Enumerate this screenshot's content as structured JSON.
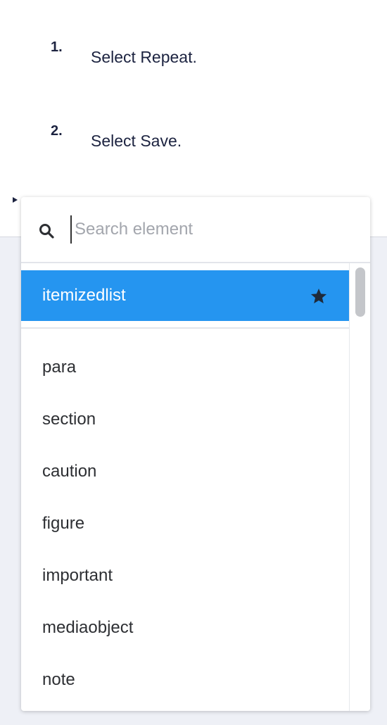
{
  "steps": [
    {
      "number": "1.",
      "text": "Select Repeat."
    },
    {
      "number": "2.",
      "text": "Select Save."
    }
  ],
  "dropdown": {
    "search": {
      "placeholder": "Search element",
      "icon": "search-icon"
    },
    "favorites": [
      {
        "label": "itemizedlist",
        "icon": "star-icon",
        "selected": true
      }
    ],
    "items": [
      {
        "label": "para"
      },
      {
        "label": "section"
      },
      {
        "label": "caution"
      },
      {
        "label": "figure"
      },
      {
        "label": "important"
      },
      {
        "label": "mediaobject"
      },
      {
        "label": "note"
      }
    ]
  },
  "colors": {
    "selected_bg": "#2595f0",
    "text_dark": "#1c2340",
    "backdrop": "#eef0f6"
  }
}
